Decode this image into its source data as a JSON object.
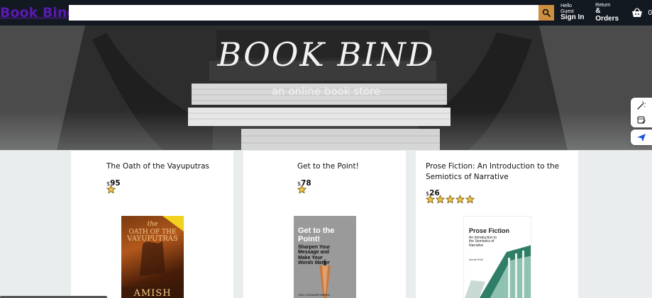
{
  "header": {
    "logo": "Book Bind",
    "search": {
      "placeholder": "",
      "value": ""
    },
    "account": {
      "line1": "Hello Guest",
      "line2": "Sign In"
    },
    "orders": {
      "line1": "Return",
      "line2": "& Orders"
    },
    "basket_count": "0"
  },
  "banner": {
    "title": "BOOK BIND",
    "subtitle": "an online book store"
  },
  "products": [
    {
      "title": "The Oath of the Vayuputras",
      "currency": "$",
      "price": "95",
      "rating": 1,
      "cover": {
        "line1": "the",
        "line2": "OATH OF THE",
        "line3": "VAYUPUTRAS",
        "author": "AMISH"
      }
    },
    {
      "title": "Get to the Point!",
      "currency": "$",
      "price": "78",
      "rating": 1,
      "cover": {
        "line1": "Get to the Point!",
        "line2": "Sharpen Your",
        "line3": "Message and",
        "line4": "Make Your",
        "line5": "Words Matter",
        "author": "JOEL SCHWARTZBERG"
      }
    },
    {
      "title": "Prose Fiction: An Introduction to the Semiotics of Narrative",
      "currency": "$",
      "price": "26",
      "rating": 5,
      "cover": {
        "line1": "Prose Fiction",
        "line2": "An Introduction to",
        "line3": "the Semiotics of",
        "line4": "Narrative",
        "author": "Ismail Reid"
      }
    }
  ],
  "colors": {
    "header_bg": "#131921",
    "logo": "#5a1ab1",
    "search_btn": "#cd9042",
    "star": "#f0c14b",
    "page_bg": "#eaeded"
  }
}
